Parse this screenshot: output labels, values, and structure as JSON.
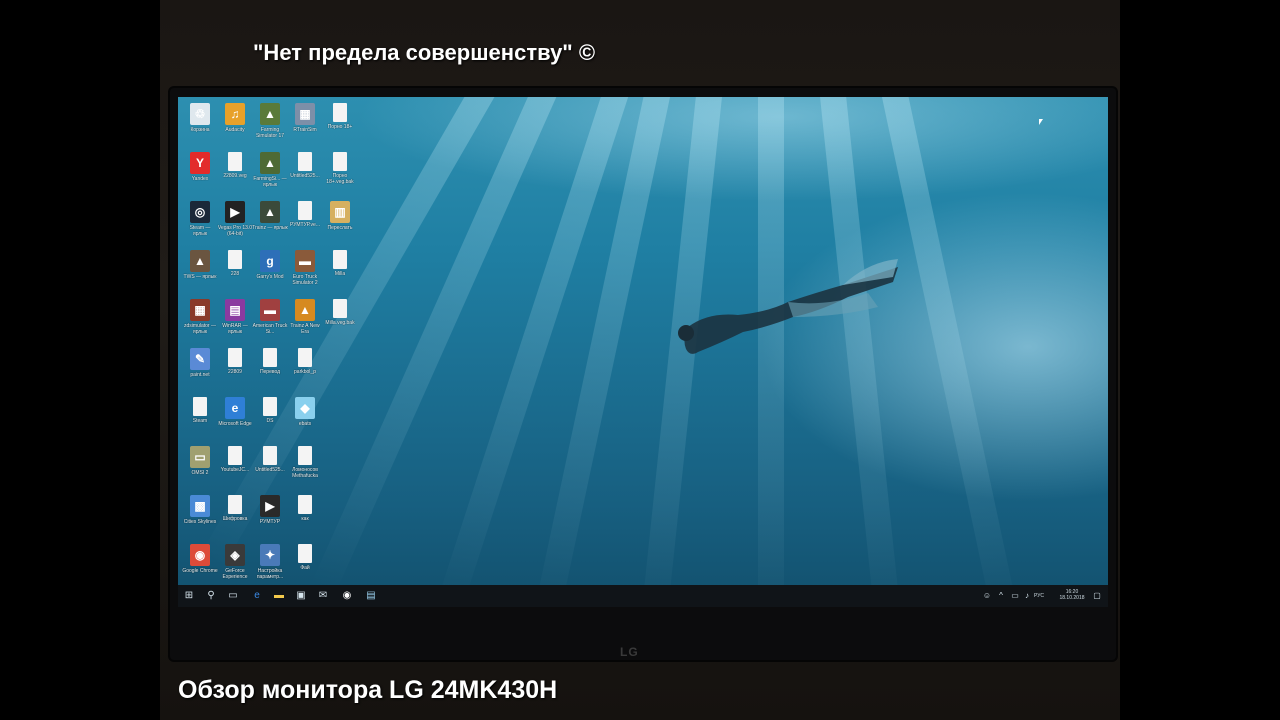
{
  "captions": {
    "top": "\"Нет предела совершенству\" ©",
    "bottom": "Обзор монитора LG 24MK430H"
  },
  "monitor": {
    "brand_logo": "LG"
  },
  "desktop": {
    "wallpaper": "underwater-diver",
    "icons": [
      {
        "label": "Корзина",
        "icon": "recycle-bin-icon",
        "color": "#dfe8ee"
      },
      {
        "label": "Audacity",
        "icon": "audacity-icon",
        "color": "#e8a12a"
      },
      {
        "label": "Farming Simulator 17",
        "icon": "game-icon",
        "color": "#5a7a3a"
      },
      {
        "label": "RTrainSim",
        "icon": "train-icon",
        "color": "#7d8fa8"
      },
      {
        "label": "Порно 18+",
        "icon": "file-icon",
        "color": "#f4f4f4"
      },
      {
        "label": "Yandex",
        "icon": "yandex-icon",
        "color": "#e32b2b"
      },
      {
        "label": "22809.veg",
        "icon": "file-icon",
        "color": "#f4f4f4"
      },
      {
        "label": "FarmingSi... — ярлык",
        "icon": "game-icon",
        "color": "#4e6a35"
      },
      {
        "label": "Untitled525...",
        "icon": "file-icon",
        "color": "#f4f4f4"
      },
      {
        "label": "Порно 18+.veg.bak",
        "icon": "file-icon",
        "color": "#f4f4f4"
      },
      {
        "label": "Steam — ярлык",
        "icon": "steam-icon",
        "color": "#1b2838"
      },
      {
        "label": "Vegas Pro 13.0 (64-bit)",
        "icon": "vegas-icon",
        "color": "#222222"
      },
      {
        "label": "Trainz — ярлык",
        "icon": "game-icon",
        "color": "#3b4a3a"
      },
      {
        "label": "РУМТУР.ve...",
        "icon": "file-icon",
        "color": "#f4f4f4"
      },
      {
        "label": "Переслать",
        "icon": "archive-icon",
        "color": "#d6b060"
      },
      {
        "label": "TWS — ярлык",
        "icon": "game-icon",
        "color": "#6a5540"
      },
      {
        "label": "228",
        "icon": "file-icon",
        "color": "#f4f4f4"
      },
      {
        "label": "Garry's Mod",
        "icon": "gmod-icon",
        "color": "#2d6fb8"
      },
      {
        "label": "Euro Truck Simulator 2",
        "icon": "truck-icon",
        "color": "#8a5a3a"
      },
      {
        "label": "Milla",
        "icon": "file-icon",
        "color": "#f4f4f4"
      },
      {
        "label": "zdsimulator — ярлык",
        "icon": "train-icon",
        "color": "#8a3a2a"
      },
      {
        "label": "WinRAR — ярлык",
        "icon": "winrar-icon",
        "color": "#8a3aa0"
      },
      {
        "label": "American Truck Si...",
        "icon": "truck-icon",
        "color": "#a04040"
      },
      {
        "label": "Trainz A New Era",
        "icon": "game-icon",
        "color": "#d68a20"
      },
      {
        "label": "Milla.veg.bak",
        "icon": "file-icon",
        "color": "#f4f4f4"
      },
      {
        "label": "paint.net",
        "icon": "paint-icon",
        "color": "#5a8ad6"
      },
      {
        "label": "22809",
        "icon": "file-icon",
        "color": "#f4f4f4"
      },
      {
        "label": "Перевод",
        "icon": "file-icon",
        "color": "#f4f4f4"
      },
      {
        "label": "parkbol_p",
        "icon": "file-icon",
        "color": "#f4f4f4"
      },
      {
        "label": "Steam",
        "icon": "file-icon",
        "color": "#f4f4f4"
      },
      {
        "label": "Microsoft Edge",
        "icon": "edge-icon",
        "color": "#2f7fd6"
      },
      {
        "label": "DS",
        "icon": "file-icon",
        "color": "#f4f4f4"
      },
      {
        "label": "ebats",
        "icon": "crystal-icon",
        "color": "#8ad0ee"
      },
      {
        "label": "OMSI 2",
        "icon": "bus-icon",
        "color": "#a0a070"
      },
      {
        "label": "YoutubeJC...",
        "icon": "file-icon",
        "color": "#f4f4f4"
      },
      {
        "label": "Untitled525...",
        "icon": "file-icon",
        "color": "#f4f4f4"
      },
      {
        "label": "Ломоносов Methafucka",
        "icon": "file-icon",
        "color": "#f4f4f4"
      },
      {
        "label": "Cities Skylines",
        "icon": "city-icon",
        "color": "#4a8ad6"
      },
      {
        "label": "Шифровка",
        "icon": "file-icon",
        "color": "#f4f4f4"
      },
      {
        "label": "РУМТУР",
        "icon": "vegas-icon",
        "color": "#2a2a2a"
      },
      {
        "label": "как",
        "icon": "file-icon",
        "color": "#f4f4f4"
      },
      {
        "label": "Google Chrome",
        "icon": "chrome-icon",
        "color": "#dd4b39"
      },
      {
        "label": "GeForce Experience",
        "icon": "nvidia-icon",
        "color": "#3a3a3a"
      },
      {
        "label": "Настройка параметр...",
        "icon": "settings-icon",
        "color": "#4a7ab8"
      },
      {
        "label": "Фай",
        "icon": "file-icon",
        "color": "#f4f4f4"
      }
    ]
  },
  "taskbar": {
    "items": [
      "start-icon",
      "search-icon",
      "task-view-icon",
      "edge-icon",
      "folder-icon",
      "store-icon",
      "mail-icon",
      "chrome-icon",
      "app-icon"
    ],
    "lang": "РУС",
    "time": "16:20",
    "date": "18.10.2018"
  }
}
